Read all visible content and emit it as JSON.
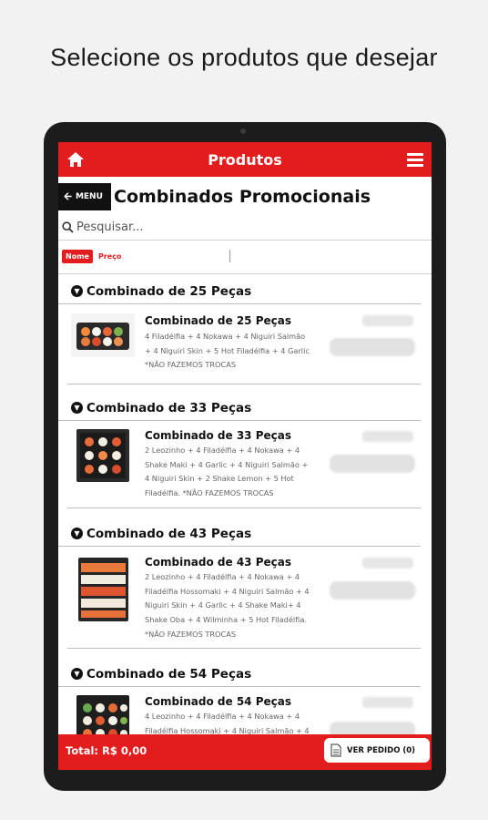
{
  "caption": "Selecione os produtos que desejar",
  "header": {
    "title": "Produtos"
  },
  "category": {
    "back_label": "MENU",
    "title": "Combinados Promocionais"
  },
  "search": {
    "placeholder": "Pesquisar..."
  },
  "sort": {
    "name_label": "Nome",
    "price_label": "Preço"
  },
  "groups": [
    {
      "title": "Combinado de 25 Peças",
      "product": {
        "name": "Combinado de 25 Peças",
        "desc": [
          "4 Filadélfia + 4 Nokawa + 4 Niguiri Salmão",
          "+ 4 Niguiri Skin + 5 Hot Filadélfia + 4 Garlic",
          "*NÃO FAZEMOS TROCAS"
        ]
      }
    },
    {
      "title": "Combinado de 33 Peças",
      "product": {
        "name": "Combinado de 33 Peças",
        "desc": [
          "2 Leozinho + 4 Filadélfia + 4 Nokawa + 4",
          "Shake Maki + 4 Garlic + 4 Niguiri Salmão +",
          "4 Niguiri Skin + 2 Shake Lemon + 5 Hot",
          "Filadélfia. *NÃO FAZEMOS TROCAS"
        ]
      }
    },
    {
      "title": "Combinado de 43 Peças",
      "product": {
        "name": "Combinado de 43 Peças",
        "desc": [
          "2 Leozinho + 4 Filadélfia + 4 Nokawa + 4",
          "Filadélfia Hossomaki + 4 Niguiri Salmão + 4",
          "Niguiri Skin + 4 Garlic + 4 Shake Maki+ 4",
          "Shake Oba + 4 Wilminha + 5 Hot Filadélfia.",
          "*NÃO FAZEMOS TROCAS"
        ]
      }
    },
    {
      "title": "Combinado de 54 Peças",
      "product": {
        "name": "Combinado de 54 Peças",
        "desc": [
          "4 Leozinho + 4 Filadélfia + 4 Nokawa + 4",
          "Filadélfia Hossomaki + 4 Niguiri Salmão + 4"
        ]
      }
    }
  ],
  "footer": {
    "total_label": "Total: R$ 0,00",
    "order_label": "VER PEDIDO (0)"
  },
  "colors": {
    "accent": "#e31d1d",
    "dark": "#111111"
  }
}
